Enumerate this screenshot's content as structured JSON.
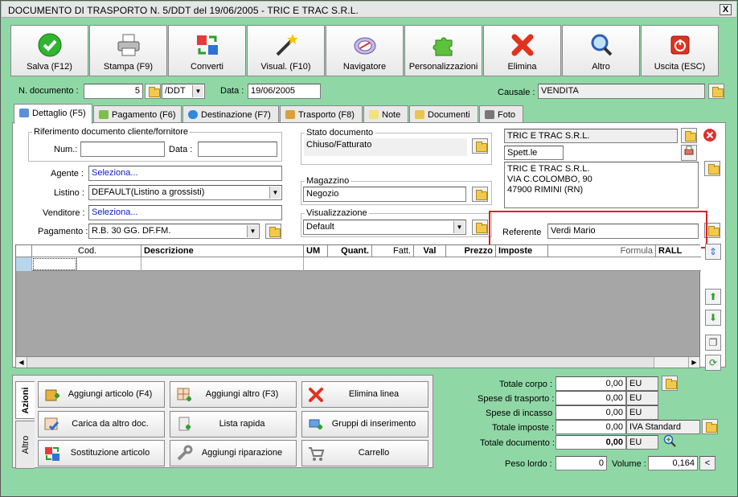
{
  "window": {
    "title": "DOCUMENTO DI TRASPORTO N. 5/DDT del 19/06/2005 - TRIC E TRAC S.R.L.",
    "close": "X"
  },
  "toolbar": [
    {
      "label": "Salva (F12)",
      "icon": "check-icon"
    },
    {
      "label": "Stampa (F9)",
      "icon": "printer-icon"
    },
    {
      "label": "Converti",
      "icon": "convert-icon"
    },
    {
      "label": "Visual. (F10)",
      "icon": "magic-wand-icon"
    },
    {
      "label": "Navigatore",
      "icon": "compass-icon"
    },
    {
      "label": "Personalizzazioni",
      "icon": "puzzle-icon"
    },
    {
      "label": "Elimina",
      "icon": "delete-x-icon"
    },
    {
      "label": "Altro",
      "icon": "search-icon"
    },
    {
      "label": "Uscita (ESC)",
      "icon": "exit-icon"
    }
  ],
  "header": {
    "ndoc_label": "N. documento :",
    "ndoc_value": "5",
    "series": "/DDT",
    "date_label": "Data :",
    "date_value": "19/06/2005",
    "causale_label": "Causale :",
    "causale_value": "VENDITA"
  },
  "tabs": [
    "Dettaglio (F5)",
    "Pagamento (F6)",
    "Destinazione (F7)",
    "Trasporto (F8)",
    "Note",
    "Documenti",
    "Foto"
  ],
  "rif": {
    "legend": "Riferimento documento cliente/fornitore",
    "num_label": "Num.:",
    "data_label": "Data :"
  },
  "fields": {
    "agente_label": "Agente :",
    "agente_value": "Seleziona...",
    "listino_label": "Listino :",
    "listino_value": "DEFAULT(Listino a grossisti)",
    "venditore_label": "Venditore :",
    "venditore_value": "Seleziona...",
    "pagamento_label": "Pagamento :",
    "pagamento_value": "R.B. 30 GG. DF.FM."
  },
  "stato": {
    "legend": "Stato documento",
    "value": "Chiuso/Fatturato"
  },
  "magazzino": {
    "legend": "Magazzino",
    "value": "Negozio"
  },
  "visualizzazione": {
    "legend": "Visualizzazione",
    "value": "Default"
  },
  "cliente": {
    "name": "TRIC E TRAC S.R.L.",
    "salutation": "Spett.le",
    "address": [
      "TRIC E TRAC S.R.L.",
      "VIA C.COLOMBO, 90",
      "47900 RIMINI (RN)"
    ],
    "referente_label": "Referente",
    "referente_value": "Verdi Mario"
  },
  "grid": {
    "columns": [
      "",
      "Cod.",
      "Descrizione",
      "UM",
      "Quant.",
      "Fatt.",
      "Val",
      "Prezzo",
      "Imposte",
      "Formula",
      "RALL"
    ]
  },
  "vtabs": {
    "azioni": "Azioni",
    "altro": "Altro"
  },
  "actions": [
    {
      "label": "Aggiungi articolo (F4)",
      "icon": "add-article-icon"
    },
    {
      "label": "Aggiungi altro (F3)",
      "icon": "add-other-icon"
    },
    {
      "label": "Elimina linea",
      "icon": "delete-line-icon"
    },
    {
      "label": "Carica da altro doc.",
      "icon": "load-doc-icon"
    },
    {
      "label": "Lista rapida",
      "icon": "quick-list-icon"
    },
    {
      "label": "Gruppi di inserimento",
      "icon": "insert-group-icon"
    },
    {
      "label": "Sostituzione articolo",
      "icon": "replace-article-icon"
    },
    {
      "label": "Aggiungi riparazione",
      "icon": "repair-icon"
    },
    {
      "label": "Carrello",
      "icon": "cart-icon"
    }
  ],
  "totals": [
    {
      "label": "Totale corpo :",
      "value": "0,00",
      "unit": "EU"
    },
    {
      "label": "Spese di trasporto :",
      "value": "0,00",
      "unit": "EU"
    },
    {
      "label": "Spese di incasso :",
      "value": "0,00",
      "unit": "EU"
    },
    {
      "label": "Totale imposte :",
      "value": "0,00",
      "unit": "IVA Standard"
    },
    {
      "label": "Totale documento :",
      "value": "0,00",
      "unit": "EU"
    }
  ],
  "weights": {
    "peso_label": "Peso lordo :",
    "peso_value": "0",
    "volume_label": "Volume :",
    "volume_value": "0,164",
    "btn": "<"
  },
  "colors": {
    "window_bg": "#8fd8a6",
    "highlight": "#e02020",
    "link": "#1020c0"
  }
}
